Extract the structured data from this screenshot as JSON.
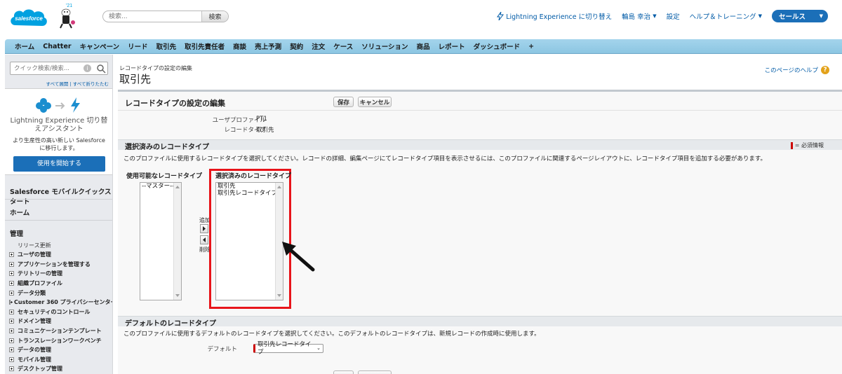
{
  "header": {
    "logo_text": "salesforce",
    "mascot_year": "'21",
    "search_placeholder": "検索...",
    "search_button": "検索",
    "lightning_switch": "Lightning Experience に切り替え",
    "user_name": "輪島 幸治",
    "setup": "設定",
    "help_training": "ヘルプ＆トレーニング",
    "app_name": "セールス"
  },
  "tabs": [
    "ホーム",
    "Chatter",
    "キャンペーン",
    "リード",
    "取引先",
    "取引先責任者",
    "商談",
    "売上予測",
    "契約",
    "注文",
    "ケース",
    "ソリューション",
    "商品",
    "レポート",
    "ダッシュボード",
    "+"
  ],
  "sidebar": {
    "quick_find_placeholder": "クイック検索/検索...",
    "expand_all": "すべて展開",
    "collapse_all": "すべて折りたたむ",
    "link_separator": "|",
    "lightning_title": "Lightning Experience 切り替えアシスタント",
    "lightning_desc": "より生産性の高い新しい Salesforce に移行します。",
    "lightning_button": "使用を開始する",
    "mobile_quickstart": "Salesforce モバイルクイックスタート",
    "home": "ホーム",
    "admin": "管理",
    "release_updates": "リリース更新",
    "tree": [
      "ユーザの管理",
      "アプリケーションを管理する",
      "テリトリーの管理",
      "組織プロファイル",
      "データ分類",
      "Customer 360 プライバシーセンター",
      "セキュリティのコントロール",
      "ドメイン管理",
      "コミュニケーションテンプレート",
      "トランスレーションワークベンチ",
      "データの管理",
      "モバイル管理",
      "デスクトップ管理"
    ]
  },
  "page": {
    "breadcrumb": "レコードタイプの設定の編集",
    "title": "取引先",
    "help_link": "このページのヘルプ",
    "help_icon": "?"
  },
  "panel": {
    "title": "レコードタイプの設定の編集",
    "save": "保存",
    "cancel": "キャンセル",
    "user_profile_label": "ユーザプロファイル",
    "user_profile_value": "PT1",
    "record_type_label": "レコードタイプ",
    "record_type_value": "取引先"
  },
  "selected_section": {
    "title": "選択済みのレコードタイプ",
    "required_legend": "= 必須情報",
    "description": "このプロファイルに使用するレコードタイプを選択してください。レコードの詳細、編集ページにてレコードタイプ項目を表示させるには、このプロファイルに関連するページレイアウトに、レコードタイプ項目を追加する必要があります。",
    "available_label": "使用可能なレコードタイプ",
    "available_options": [
      "--マスター--"
    ],
    "add_label": "追加",
    "remove_label": "削除",
    "selected_label": "選択済みのレコードタイプ",
    "selected_options": [
      "取引先",
      "取引先レコードタイプ"
    ]
  },
  "default_section": {
    "title": "デフォルトのレコードタイプ",
    "description": "このプロファイルに使用するデフォルトのレコードタイプを選択してください。このデフォルトのレコードタイプは、新規レコードの作成時に使用します。",
    "default_label": "デフォルト",
    "default_value": "取引先レコードタイプ"
  },
  "colors": {
    "tab_bar": "#99cde8",
    "brand_blue": "#1b6fb8",
    "highlight_red": "#e8141a",
    "link_blue": "#015ba7"
  }
}
